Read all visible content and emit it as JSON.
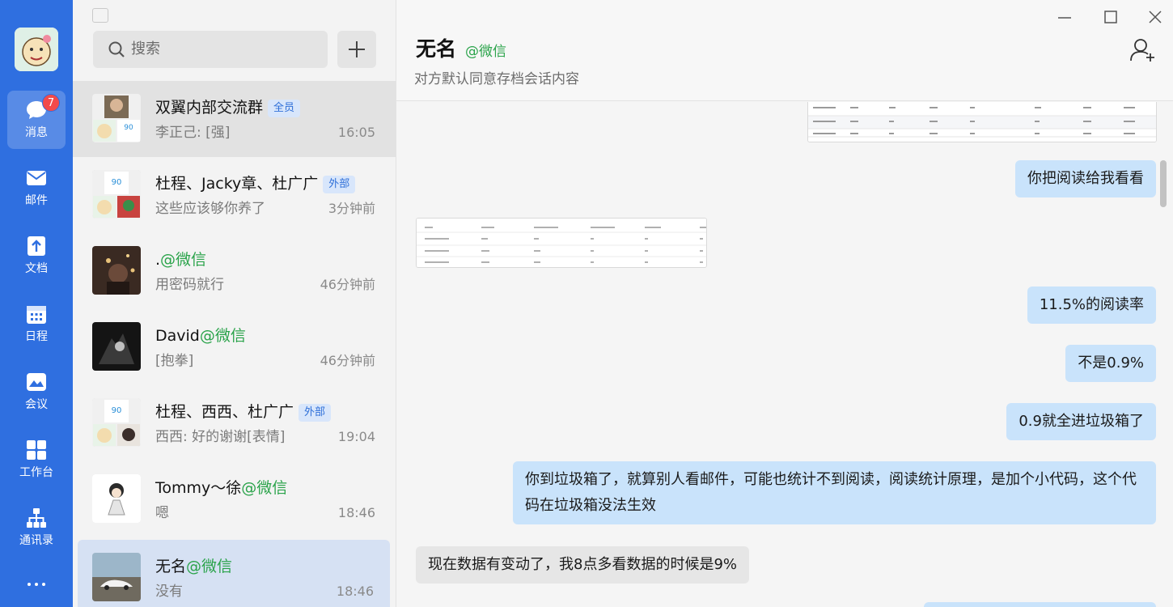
{
  "nav": {
    "items": [
      {
        "label": "消息",
        "badge": "7"
      },
      {
        "label": "邮件"
      },
      {
        "label": "文档"
      },
      {
        "label": "日程"
      },
      {
        "label": "会议"
      },
      {
        "label": "工作台"
      },
      {
        "label": "通讯录"
      }
    ]
  },
  "search": {
    "placeholder": "搜索"
  },
  "conversations": [
    {
      "name": "双翼内部交流群",
      "tag": "全员",
      "msg": "李正己: [强]",
      "time": "16:05"
    },
    {
      "name": "杜程、Jacky章、杜广广",
      "tag": "外部",
      "msg": "这些应该够你养了",
      "time": "3分钟前"
    },
    {
      "name": ".",
      "wx": "@微信",
      "msg": "用密码就行",
      "time": "46分钟前"
    },
    {
      "name": "David",
      "wx": "@微信",
      "msg": "[抱拳]",
      "time": "46分钟前"
    },
    {
      "name": "杜程、西西、杜广广",
      "tag": "外部",
      "msg": "西西: 好的谢谢[表情]",
      "time": "19:04"
    },
    {
      "name": "Tommy～徐",
      "wx": "@微信",
      "msg": "嗯",
      "time": "18:46"
    },
    {
      "name": "无名",
      "wx": "@微信",
      "msg": "没有",
      "time": "18:46"
    }
  ],
  "chat": {
    "title": "无名",
    "title_wx": "@微信",
    "subtitle": "对方默认同意存档会话内容",
    "messages": [
      {
        "dir": "out",
        "text": "你把阅读给我看看"
      },
      {
        "dir": "out",
        "text": "11.5%的阅读率"
      },
      {
        "dir": "out",
        "text": "不是0.9%"
      },
      {
        "dir": "out",
        "text": "0.9就全进垃圾箱了"
      },
      {
        "dir": "out",
        "text": "你到垃圾箱了，就算别人看邮件，可能也统计不到阅读，阅读统计原理，是加个小代码，这个代码在垃圾箱没法生效"
      },
      {
        "dir": "in",
        "text": "现在数据有变动了，我8点多看数据的时候是9%"
      }
    ]
  },
  "colors": {
    "rail": "#2f6fe0",
    "outgoing": "#c9e3fb",
    "wechat_green": "#2aa34a",
    "badge": "#f24a4a"
  }
}
